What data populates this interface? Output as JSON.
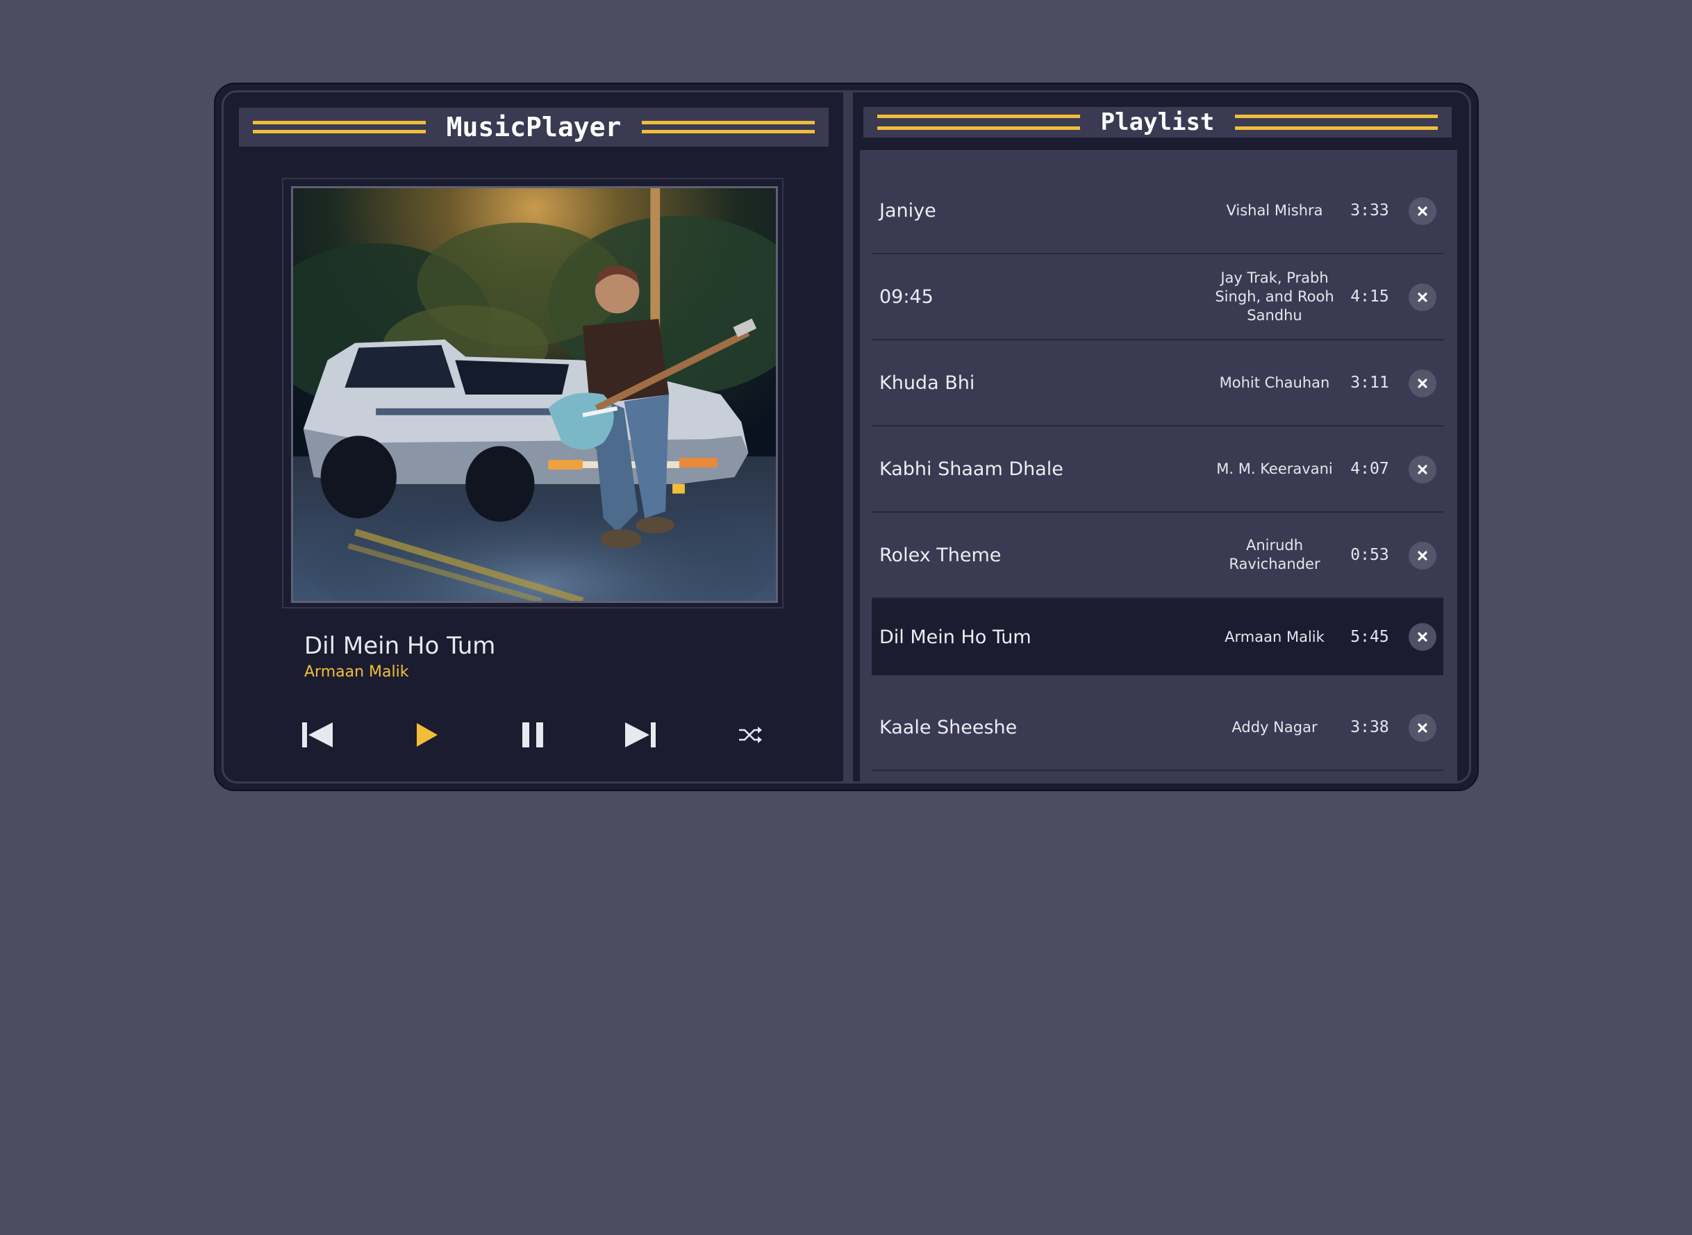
{
  "player": {
    "title": "MusicPlayer",
    "now_playing": {
      "title": "Dil Mein Ho Tum",
      "artist": "Armaan Malik"
    },
    "album_art": "artwork-man-with-guitar-sitting-on-car",
    "controls": {
      "previous_icon": "skip-previous-icon",
      "play_icon": "play-icon",
      "pause_icon": "pause-icon",
      "next_icon": "skip-next-icon",
      "shuffle_icon": "shuffle-icon"
    }
  },
  "playlist": {
    "title": "Playlist",
    "remove_icon": "close-icon",
    "tracks": [
      {
        "title": "Janiye",
        "artist": "Vishal Mishra",
        "duration": "3:33",
        "active": false
      },
      {
        "title": "09:45",
        "artist": "Jay Trak, Prabh Singh, and Rooh Sandhu",
        "duration": "4:15",
        "active": false
      },
      {
        "title": "Khuda Bhi",
        "artist": "Mohit Chauhan",
        "duration": "3:11",
        "active": false
      },
      {
        "title": "Kabhi Shaam Dhale",
        "artist": "M. M. Keeravani",
        "duration": "4:07",
        "active": false
      },
      {
        "title": "Rolex Theme",
        "artist": "Anirudh Ravichander",
        "duration": "0:53",
        "active": false
      },
      {
        "title": "Dil Mein Ho Tum",
        "artist": "Armaan Malik",
        "duration": "5:45",
        "active": true
      },
      {
        "title": "Kaale Sheeshe",
        "artist": "Addy Nagar",
        "duration": "3:38",
        "active": false
      }
    ]
  },
  "colors": {
    "background": "#4c4d61",
    "panel": "#1c1c30",
    "panel_light": "#3a3b52",
    "accent": "#f2be3a",
    "text": "#ececf2"
  }
}
